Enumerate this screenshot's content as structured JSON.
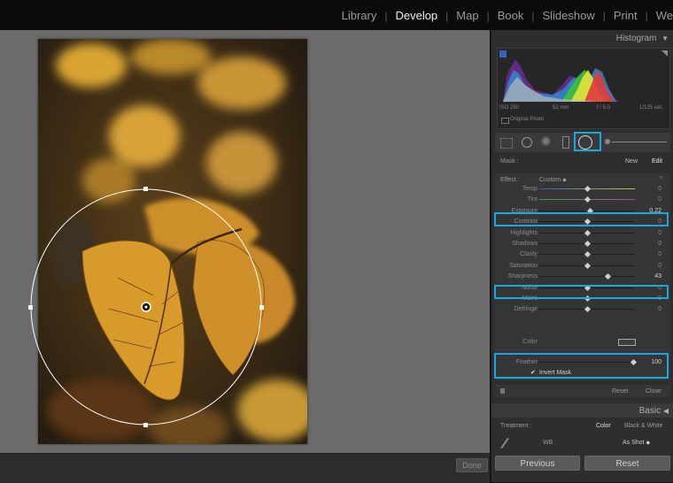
{
  "nav": {
    "modules": [
      "Library",
      "Develop",
      "Map",
      "Book",
      "Slideshow",
      "Print",
      "We"
    ],
    "active": "Develop",
    "separator": "|"
  },
  "canvas": {
    "done_label": "Done"
  },
  "histogram": {
    "title": "Histogram",
    "iso": "ISO 250",
    "focal": "52 mm",
    "aperture": "f / 5.0",
    "shutter": "1/125 sec",
    "original_photo": "Original Photo"
  },
  "mask": {
    "label": "Mask :",
    "new": "New",
    "edit": "Edit",
    "effect_label": "Effect :",
    "effect_value": "Custom",
    "sliders": [
      {
        "label": "Temp",
        "value": "0",
        "pos": 0.5
      },
      {
        "label": "Tint",
        "value": "0",
        "pos": 0.5
      },
      {
        "label": "Exposure",
        "value": "0.22",
        "pos": 0.53
      },
      {
        "label": "Contrast",
        "value": "0",
        "pos": 0.5
      },
      {
        "label": "Highlights",
        "value": "0",
        "pos": 0.5
      },
      {
        "label": "Shadows",
        "value": "0",
        "pos": 0.5
      },
      {
        "label": "Clarity",
        "value": "0",
        "pos": 0.5
      },
      {
        "label": "Saturation",
        "value": "0",
        "pos": 0.5
      },
      {
        "label": "Sharpness",
        "value": "43",
        "pos": 0.71
      },
      {
        "label": "Noise",
        "value": "0",
        "pos": 0.5
      },
      {
        "label": "Moiré",
        "value": "0",
        "pos": 0.5
      },
      {
        "label": "Defringe",
        "value": "0",
        "pos": 0.5
      }
    ],
    "color_label": "Color",
    "feather_label": "Feather",
    "feather_value": "100",
    "feather_pos": 1.0,
    "invert_mask": "Invert Mask",
    "invert_checked": "✔",
    "reset": "Reset",
    "close": "Close"
  },
  "basic": {
    "title": "Basic",
    "treatment_label": "Treatment :",
    "color": "Color",
    "bw": "Black & White",
    "wb_label": "WB :",
    "wb_value": "As Shot"
  },
  "footer": {
    "previous": "Previous",
    "reset": "Reset"
  },
  "colors": {
    "accent": "#1ba7e0",
    "panel": "#2e2e2e",
    "canvas": "#6b6b6b"
  }
}
